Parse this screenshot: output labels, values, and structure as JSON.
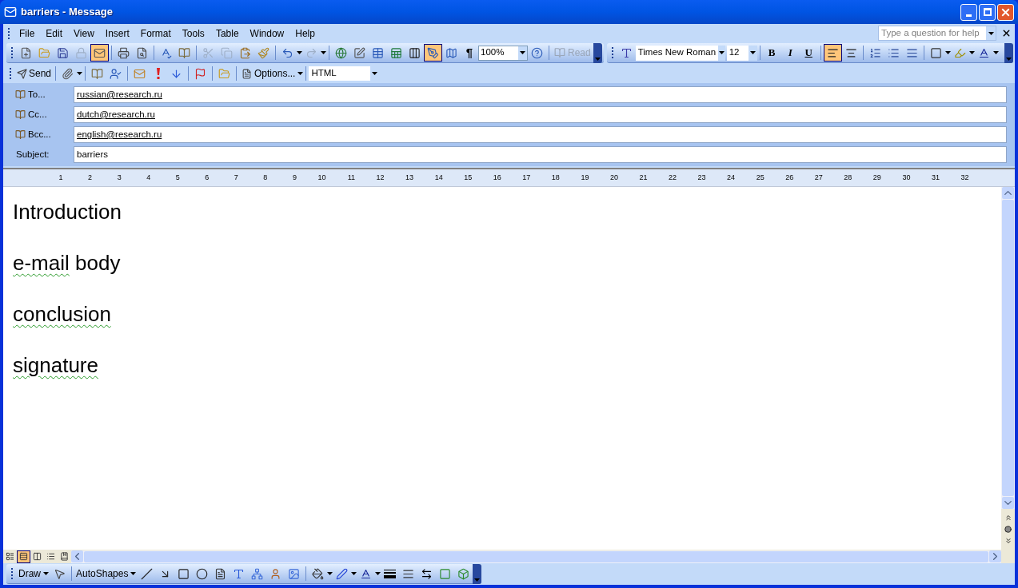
{
  "window": {
    "title": "barriers - Message"
  },
  "menu": [
    "File",
    "Edit",
    "View",
    "Insert",
    "Format",
    "Tools",
    "Table",
    "Window",
    "Help"
  ],
  "help_box": {
    "placeholder": "Type a question for help"
  },
  "standard_toolbar": {
    "buttons": [
      {
        "selected": false,
        "disabled": false
      },
      {
        "selected": false,
        "disabled": false
      },
      {
        "selected": false,
        "disabled": false
      },
      {
        "selected": false,
        "disabled": true
      },
      {
        "selected": true,
        "disabled": false
      },
      {
        "selected": false,
        "disabled": false
      },
      {
        "selected": false,
        "disabled": false
      },
      {
        "selected": false,
        "disabled": false
      },
      {
        "selected": false,
        "disabled": false
      },
      {
        "selected": false,
        "disabled": true
      },
      {
        "selected": false,
        "disabled": true
      },
      {
        "selected": false,
        "disabled": false
      },
      {
        "selected": false,
        "disabled": false
      },
      {
        "selected": false,
        "disabled": false
      },
      {
        "selected": false,
        "disabled": true
      },
      {
        "selected": false,
        "disabled": false
      },
      {
        "selected": false,
        "disabled": false
      },
      {
        "selected": false,
        "disabled": false
      },
      {
        "selected": false,
        "disabled": false
      },
      {
        "selected": false,
        "disabled": false
      },
      {
        "selected": true,
        "disabled": false
      },
      {
        "selected": false,
        "disabled": false
      }
    ],
    "pilcrow": "¶",
    "zoom": "100%",
    "read_button": {
      "label": "Read",
      "disabled": true
    }
  },
  "formatting_toolbar": {
    "font": "Times New Roman",
    "size": "12",
    "styles": [
      {
        "label": "B",
        "selected": false
      },
      {
        "label": "I",
        "selected": false
      },
      {
        "label": "U",
        "selected": false
      }
    ],
    "align": [
      {
        "selected": true
      },
      {
        "selected": false
      }
    ]
  },
  "email_toolbar": {
    "send": "Send",
    "options": "Options...",
    "format": "HTML"
  },
  "recipients": [
    {
      "label": "To...",
      "value": "russian@research.ru"
    },
    {
      "label": "Cc...",
      "value": "dutch@research.ru"
    },
    {
      "label": "Bcc...",
      "value": "english@research.ru"
    }
  ],
  "subject": {
    "label": "Subject:",
    "value": "barriers"
  },
  "ruler": {
    "marks": [
      "1",
      "2",
      "3",
      "4",
      "5",
      "6",
      "7",
      "8",
      "9",
      "10",
      "11",
      "12",
      "13",
      "14",
      "15",
      "16",
      "17",
      "18",
      "19",
      "20",
      "21",
      "22",
      "23",
      "24",
      "25",
      "26",
      "27",
      "28",
      "29",
      "30",
      "31",
      "32"
    ]
  },
  "body": {
    "paragraphs": [
      {
        "segments": [
          {
            "text": "Introduction",
            "flagged": false
          }
        ]
      },
      {
        "segments": [
          {
            "text": "e-mail",
            "flagged": true
          },
          {
            "text": " body",
            "flagged": false
          }
        ]
      },
      {
        "segments": [
          {
            "text": "conclusion",
            "flagged": true
          }
        ]
      },
      {
        "segments": [
          {
            "text": "signature",
            "flagged": true
          }
        ]
      }
    ]
  },
  "view_buttons": [
    {
      "selected": false
    },
    {
      "selected": true
    },
    {
      "selected": false
    },
    {
      "selected": false
    },
    {
      "selected": false
    }
  ],
  "draw_toolbar": {
    "draw": "Draw",
    "autoshapes": "AutoShapes"
  }
}
